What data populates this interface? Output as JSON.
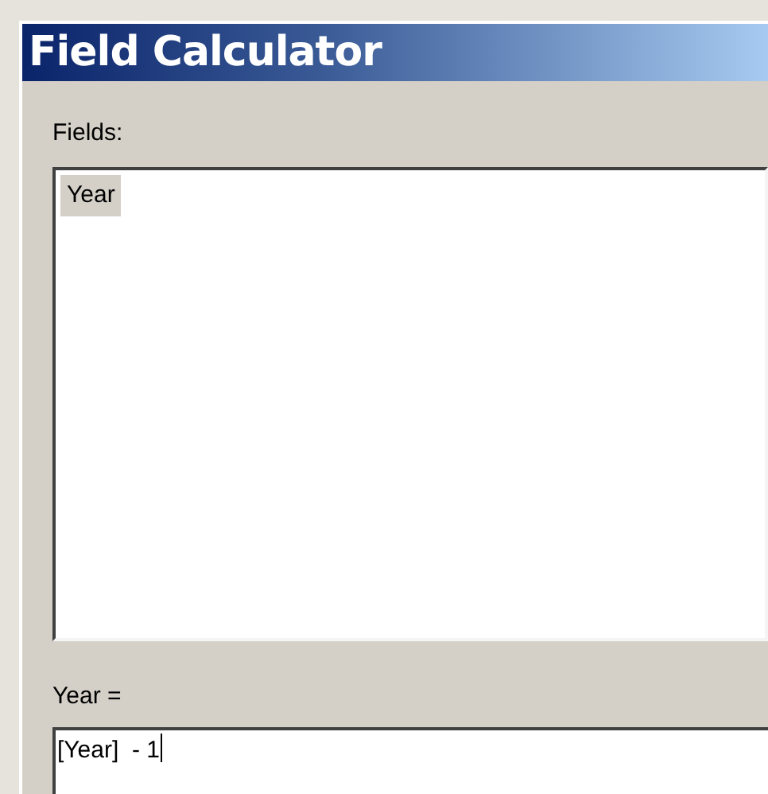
{
  "window": {
    "title": "Field Calculator"
  },
  "fields": {
    "label": "Fields:",
    "items": [
      {
        "label": "Year",
        "selected": true
      }
    ]
  },
  "expression": {
    "label": "Year =",
    "value": "[Year]  - 1"
  }
}
